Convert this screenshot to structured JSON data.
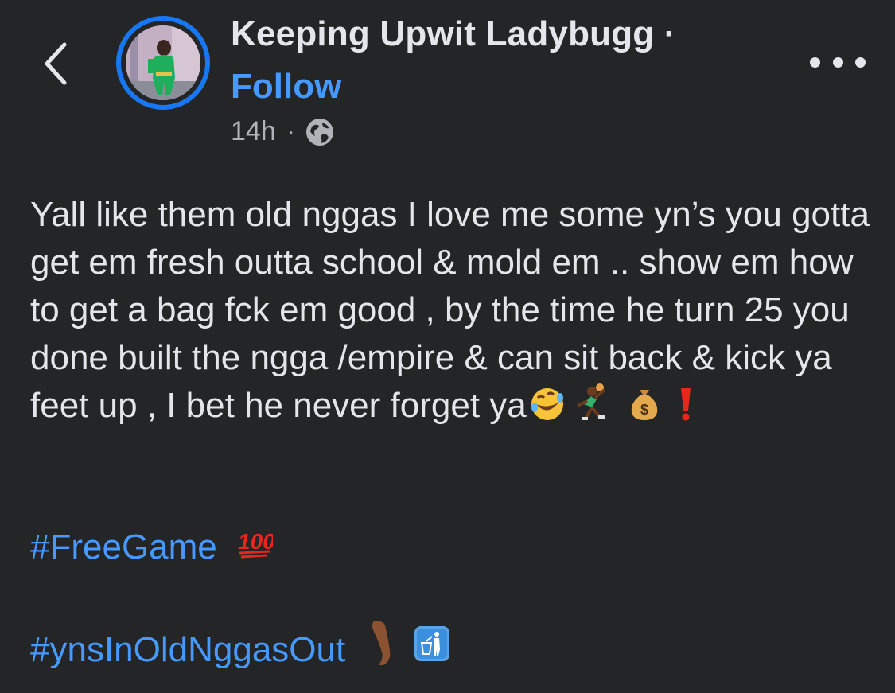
{
  "header": {
    "back_icon": "chevron-left-icon",
    "author_name": "Keeping Upwit Ladybugg ·",
    "follow_label": "Follow",
    "timestamp": "14h",
    "separator": "·",
    "audience_icon": "globe-icon",
    "more_icon": "more-horizontal-icon"
  },
  "post": {
    "text": "Yall like them old nggas I love me some yn’s you gotta get em fresh outta school & mold em .. show em how to get a bag fck em good , by the time he turn 25 you done built the ngga /empire & can sit back & kick ya feet up , I bet he never forget ya",
    "trailing_emojis": [
      "rolling-on-floor-laughing-emoji",
      "person-playing-handball-emoji",
      "money-bag-emoji",
      "red-exclamation-emoji"
    ],
    "hashtags": [
      {
        "label": "#FreeGame",
        "emoji": "hundred-points-emoji"
      },
      {
        "label": "#ynsInOldNggasOut",
        "emoji": "leg-emoji",
        "emoji2": "trash-symbol-emoji"
      }
    ]
  },
  "colors": {
    "background": "#242526",
    "text": "#e4e6eb",
    "link": "#4599ff",
    "secondary": "#b0b3b8",
    "avatar_ring": "#1877f2"
  }
}
